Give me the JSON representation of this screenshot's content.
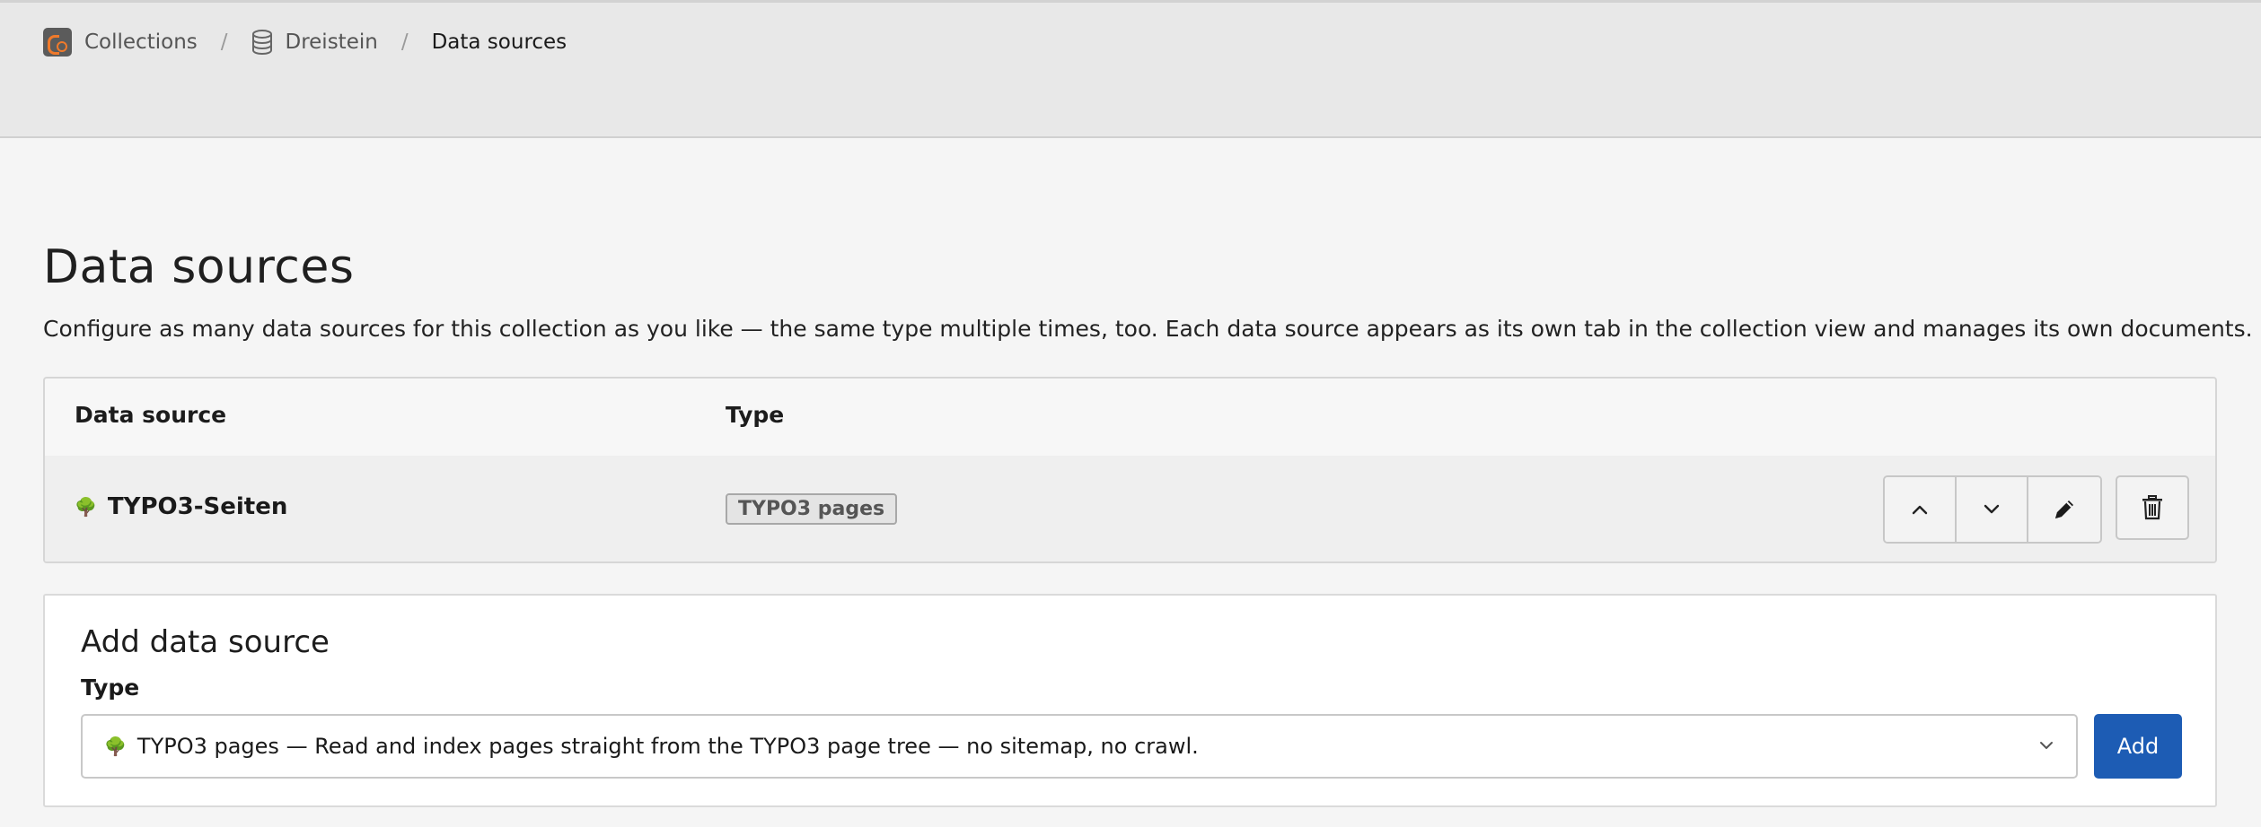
{
  "breadcrumb": {
    "items": [
      {
        "label": "Collections",
        "icon": "collections-logo-icon"
      },
      {
        "label": "Dreistein",
        "icon": "database-icon"
      },
      {
        "label": "Data sources"
      }
    ],
    "separator": "/"
  },
  "page": {
    "title": "Data sources",
    "description": "Configure as many data sources for this collection as you like — the same type multiple times, too. Each data source appears as its own tab in the collection view and manages its own documents."
  },
  "table": {
    "headers": {
      "source": "Data source",
      "type": "Type"
    },
    "rows": [
      {
        "name": "TYPO3-Seiten",
        "icon": "tree-icon",
        "type": "TYPO3 pages",
        "actions": [
          "move-up",
          "move-down",
          "edit",
          "delete"
        ]
      }
    ]
  },
  "add_form": {
    "title": "Add data source",
    "type_label": "Type",
    "selected_type": "TYPO3 pages — Read and index pages straight from the TYPO3 page tree — no sitemap, no crawl.",
    "selected_icon": "tree-icon",
    "add_label": "Add"
  },
  "colors": {
    "accent": "#1d5cb4",
    "header_bg": "#e8e8e8",
    "page_bg": "#f5f5f5"
  }
}
